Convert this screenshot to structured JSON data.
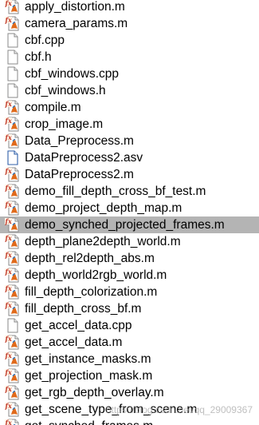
{
  "files": [
    {
      "name": "apply_distortion.m",
      "type": "matlab"
    },
    {
      "name": "camera_params.m",
      "type": "matlab"
    },
    {
      "name": "cbf.cpp",
      "type": "document"
    },
    {
      "name": "cbf.h",
      "type": "document"
    },
    {
      "name": "cbf_windows.cpp",
      "type": "document"
    },
    {
      "name": "cbf_windows.h",
      "type": "document"
    },
    {
      "name": "compile.m",
      "type": "matlab"
    },
    {
      "name": "crop_image.m",
      "type": "matlab"
    },
    {
      "name": "Data_Preprocess.m",
      "type": "matlab"
    },
    {
      "name": "DataPreprocess2.asv",
      "type": "asv"
    },
    {
      "name": "DataPreprocess2.m",
      "type": "matlab"
    },
    {
      "name": "demo_fill_depth_cross_bf_test.m",
      "type": "matlab"
    },
    {
      "name": "demo_project_depth_map.m",
      "type": "matlab"
    },
    {
      "name": "demo_synched_projected_frames.m",
      "type": "matlab",
      "selected": true
    },
    {
      "name": "depth_plane2depth_world.m",
      "type": "matlab"
    },
    {
      "name": "depth_rel2depth_abs.m",
      "type": "matlab"
    },
    {
      "name": "depth_world2rgb_world.m",
      "type": "matlab"
    },
    {
      "name": "fill_depth_colorization.m",
      "type": "matlab"
    },
    {
      "name": "fill_depth_cross_bf.m",
      "type": "matlab"
    },
    {
      "name": "get_accel_data.cpp",
      "type": "document"
    },
    {
      "name": "get_accel_data.m",
      "type": "matlab"
    },
    {
      "name": "get_instance_masks.m",
      "type": "matlab"
    },
    {
      "name": "get_projection_mask.m",
      "type": "matlab"
    },
    {
      "name": "get_rgb_depth_overlay.m",
      "type": "matlab"
    },
    {
      "name": "get_scene_type_from_scene.m",
      "type": "matlab"
    },
    {
      "name": "get_synched_frames.m",
      "type": "matlab"
    }
  ],
  "watermark": "https://blog.csdn.net/qq_29009367",
  "colors": {
    "selected_row": "#b4b4b4",
    "matlab_fx": "#c0392b",
    "matlab_blob": "#e06a1b"
  }
}
